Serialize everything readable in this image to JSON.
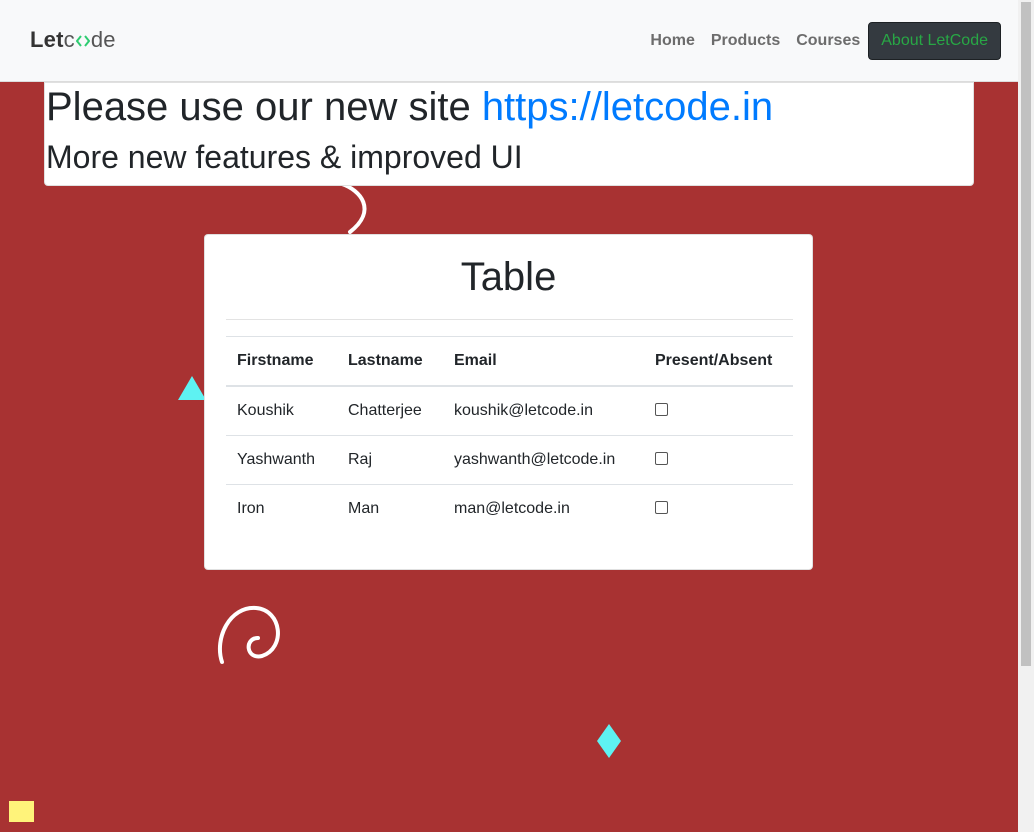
{
  "navbar": {
    "brand": {
      "part1": "Let",
      "part2": "de"
    },
    "links": [
      "Home",
      "Products",
      "Courses"
    ],
    "cta": "About LetCode"
  },
  "notice": {
    "prefix": "Please use our new site ",
    "link": "https://letcode.in",
    "subtitle": "More new features & improved UI"
  },
  "card": {
    "title": "Table",
    "headers": [
      "Firstname",
      "Lastname",
      "Email",
      "Present/Absent"
    ],
    "rows": [
      {
        "firstname": "Koushik",
        "lastname": "Chatterjee",
        "email": "koushik@letcode.in",
        "present": false
      },
      {
        "firstname": "Yashwanth",
        "lastname": "Raj",
        "email": "yashwanth@letcode.in",
        "present": false
      },
      {
        "firstname": "Iron",
        "lastname": "Man",
        "email": "man@letcode.in",
        "present": false
      }
    ]
  },
  "colors": {
    "background": "#a83232",
    "link": "#007bff",
    "cta_bg": "#343a40",
    "cta_text": "#28a745",
    "accent_cyan": "#5ef2f2",
    "accent_yellow": "#fff37a"
  }
}
